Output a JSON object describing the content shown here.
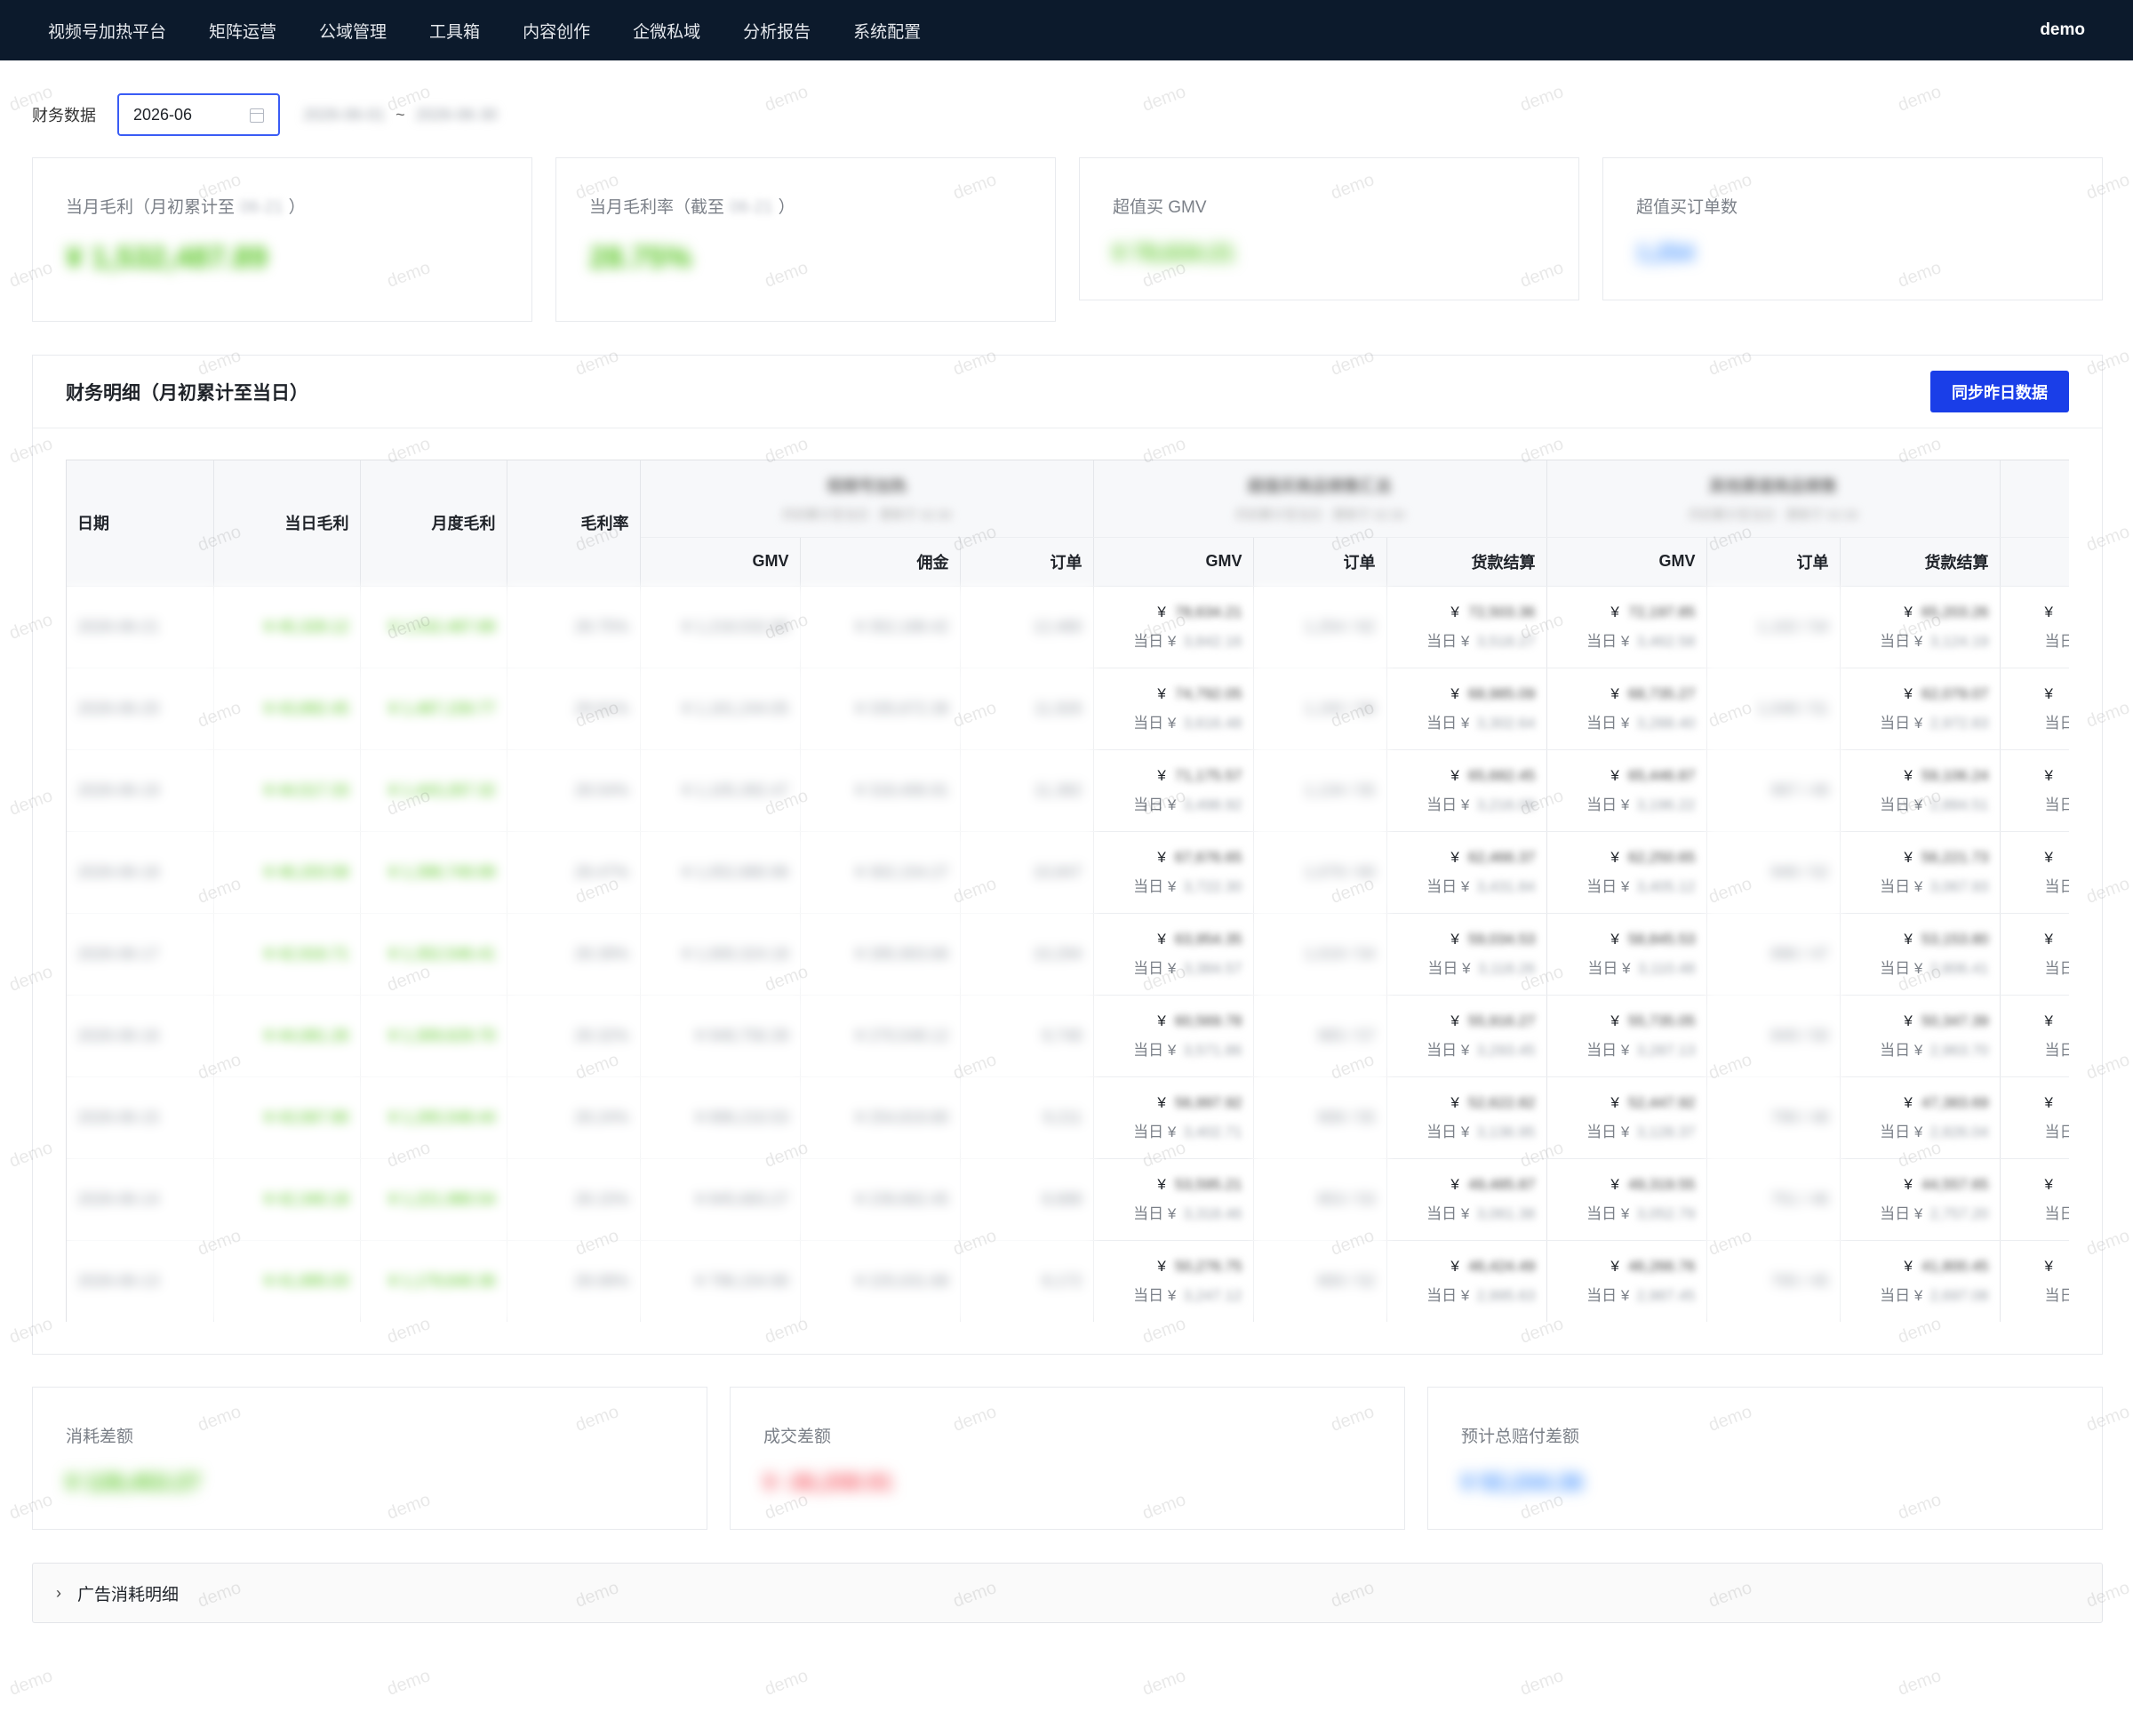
{
  "nav": {
    "items": [
      "视频号加热平台",
      "矩阵运营",
      "公域管理",
      "工具箱",
      "内容创作",
      "企微私域",
      "分析报告",
      "系统配置"
    ],
    "user": "demo"
  },
  "filter": {
    "label": "财务数据",
    "month_value": "2026-06",
    "range_start": "2026-06-01",
    "range_sep": "~",
    "range_end": "2026-06-30"
  },
  "kpis": [
    {
      "label": "当月毛利（月初累计至",
      "label_mid": "06-21",
      "label_end": "）",
      "value": "¥ 1,532,487.89"
    },
    {
      "label": "当月毛利率（截至",
      "label_mid": "06-21",
      "label_end": "）",
      "value": "28.75%"
    },
    {
      "label": "超值买 GMV",
      "value": "¥ 78,634.21"
    },
    {
      "label": "超值买订单数",
      "value": "1,254"
    }
  ],
  "detail": {
    "title": "财务明细（月初累计至当日）",
    "sync_button": "同步昨日数据",
    "columns": {
      "date": "日期",
      "daily_profit": "当日毛利",
      "monthly_profit": "月度毛利",
      "margin": "毛利率",
      "groups": [
        {
          "title": "视频号加热",
          "sub": "月初累计至当日 · 更新于 02:30"
        },
        {
          "title": "超值买商品销售汇总",
          "sub": "月初累计至当日 · 更新于 02:30"
        },
        {
          "title": "其他渠道商品销售",
          "sub": "月初累计至当日 · 更新于 02:30"
        }
      ],
      "g1": [
        "GMV",
        "佣金",
        "订单"
      ],
      "g2": [
        "GMV",
        "订单",
        "货款结算"
      ],
      "g3": [
        "GMV",
        "订单",
        "货款结算"
      ]
    },
    "today_prefix": "当日 ¥",
    "currency": "¥",
    "rows": [
      {
        "date": "2026-06-21",
        "dp": "¥ 45,328.12",
        "mp": "¥ 1,532,487.89",
        "mr": "28.75%",
        "g1gmv": "¥ 1,218,532.88",
        "g1com": "¥ 352,188.42",
        "g1ord": "12,480",
        "g2gmv": "78,634.21",
        "g2gmvd": "3,842.16",
        "g2ord": "1,254 / 62",
        "g2pay": "72,503.36",
        "g2payd": "3,518.27",
        "g3gmv": "72,197.85",
        "g3gmvd": "3,462.58",
        "g3ord": "1,102 / 54",
        "g3pay": "65,203.26",
        "g3payd": "3,124.19"
      },
      {
        "date": "2026-06-20",
        "dp": "¥ 43,892.45",
        "mp": "¥ 1,487,159.77",
        "mr": "28.61%",
        "g1gmv": "¥ 1,161,244.05",
        "g1com": "¥ 335,672.38",
        "g1ord": "11,926",
        "g2gmv": "74,792.05",
        "g2gmvd": "3,616.48",
        "g2ord": "1,192 / 58",
        "g2pay": "68,985.09",
        "g2payd": "3,302.64",
        "g3gmv": "68,735.27",
        "g3gmvd": "3,288.40",
        "g3ord": "1,048 / 51",
        "g3pay": "62,079.07",
        "g3payd": "2,972.83"
      },
      {
        "date": "2026-06-19",
        "dp": "¥ 44,517.33",
        "mp": "¥ 1,443,267.32",
        "mr": "28.54%",
        "g1gmv": "¥ 1,105,392.47",
        "g1com": "¥ 318,406.91",
        "g1ord": "11,382",
        "g2gmv": "71,175.57",
        "g2gmvd": "3,498.92",
        "g2ord": "1,134 / 55",
        "g2pay": "65,682.45",
        "g2payd": "3,216.08",
        "g3gmv": "65,446.87",
        "g3gmvd": "3,196.22",
        "g3ord": "997 / 49",
        "g3pay": "59,106.24",
        "g3payd": "2,884.51"
      },
      {
        "date": "2026-06-18",
        "dp": "¥ 46,203.58",
        "mp": "¥ 1,398,749.99",
        "mr": "28.47%",
        "g1gmv": "¥ 1,052,880.96",
        "g1com": "¥ 302,154.27",
        "g1ord": "10,847",
        "g2gmv": "67,676.65",
        "g2gmvd": "3,722.30",
        "g2ord": "1,079 / 60",
        "g2pay": "62,466.37",
        "g2payd": "3,431.84",
        "g3gmv": "62,250.65",
        "g3gmvd": "3,405.12",
        "g3ord": "948 / 52",
        "g3pay": "56,221.73",
        "g3payd": "3,067.93"
      },
      {
        "date": "2026-06-17",
        "dp": "¥ 42,916.71",
        "mp": "¥ 1,352,546.41",
        "mr": "28.39%",
        "g1gmv": "¥ 1,000,324.18",
        "g1com": "¥ 285,903.66",
        "g1ord": "10,294",
        "g2gmv": "63,954.35",
        "g2gmvd": "3,384.57",
        "g2ord": "1,019 / 54",
        "g2pay": "59,034.53",
        "g2payd": "3,118.26",
        "g3gmv": "58,845.53",
        "g3gmvd": "3,110.48",
        "g3ord": "896 / 47",
        "g3pay": "53,153.80",
        "g3payd": "2,806.41"
      },
      {
        "date": "2026-06-16",
        "dp": "¥ 44,081.26",
        "mp": "¥ 1,309,629.70",
        "mr": "28.32%",
        "g1gmv": "¥ 948,756.39",
        "g1com": "¥ 270,548.12",
        "g1ord": "9,748",
        "g2gmv": "60,569.78",
        "g2gmvd": "3,571.86",
        "g2ord": "965 / 57",
        "g2pay": "55,916.27",
        "g2payd": "3,293.45",
        "g3gmv": "55,735.05",
        "g3gmvd": "3,287.13",
        "g3ord": "849 / 50",
        "g3pay": "50,347.39",
        "g3payd": "2,963.70"
      },
      {
        "date": "2026-06-15",
        "dp": "¥ 43,567.90",
        "mp": "¥ 1,265,548.44",
        "mr": "28.24%",
        "g1gmv": "¥ 896,210.53",
        "g1com": "¥ 254,819.80",
        "g1ord": "9,211",
        "g2gmv": "56,997.92",
        "g2gmvd": "3,402.71",
        "g2ord": "908 / 55",
        "g2pay": "52,622.82",
        "g2payd": "3,136.95",
        "g3gmv": "52,447.92",
        "g3gmvd": "3,128.37",
        "g3ord": "799 / 48",
        "g3pay": "47,383.69",
        "g3payd": "2,826.04"
      },
      {
        "date": "2026-06-14",
        "dp": "¥ 42,340.18",
        "mp": "¥ 1,221,980.54",
        "mr": "28.15%",
        "g1gmv": "¥ 845,683.27",
        "g1com": "¥ 239,662.45",
        "g1ord": "8,688",
        "g2gmv": "53,595.21",
        "g2gmvd": "3,318.46",
        "g2ord": "853 / 53",
        "g2pay": "49,485.87",
        "g2payd": "3,061.38",
        "g3gmv": "49,319.55",
        "g3gmvd": "3,052.79",
        "g3ord": "751 / 46",
        "g3pay": "44,557.65",
        "g3payd": "2,757.20"
      },
      {
        "date": "2026-06-13",
        "dp": "¥ 41,895.03",
        "mp": "¥ 1,179,640.36",
        "mr": "28.08%",
        "g1gmv": "¥ 796,154.90",
        "g1com": "¥ 225,031.68",
        "g1ord": "8,172",
        "g2gmv": "50,276.75",
        "g2gmvd": "3,247.12",
        "g2ord": "800 / 52",
        "g2pay": "46,424.49",
        "g2payd": "2,995.63",
        "g3gmv": "46,266.76",
        "g3gmvd": "2,987.45",
        "g3ord": "705 / 45",
        "g3pay": "41,800.45",
        "g3payd": "2,697.08"
      }
    ]
  },
  "bottom": [
    {
      "label": "消耗差额",
      "value": "¥ 128,453.27"
    },
    {
      "label": "成交差额",
      "value": "¥ -36,208.91"
    },
    {
      "label": "预计总赔付差额",
      "value": "¥ 92,244.36"
    }
  ],
  "collapse": {
    "title": "广告消耗明细"
  },
  "watermark": "demo",
  "colors": {
    "nav_bg": "#0c1a2c",
    "primary": "#1a3ee8",
    "positive": "#52c41a",
    "negative": "#f5555f",
    "info": "#3a8cff"
  }
}
